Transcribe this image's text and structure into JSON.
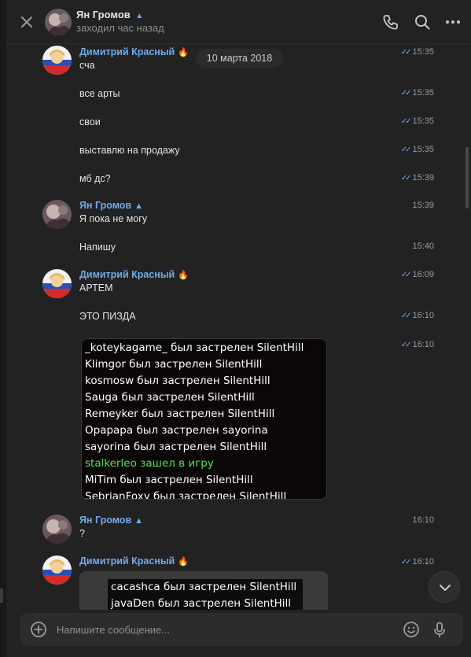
{
  "header": {
    "name": "Ян Громов",
    "status": "заходил час назад",
    "name_emoji": "🔥"
  },
  "date_separator": "10 марта 2018",
  "messages": [
    {
      "author": "Димитрий Красный",
      "emoji": "🔥",
      "text": "сча",
      "time": "15:35",
      "read": true
    },
    {
      "text": "все арты",
      "time": "15:35",
      "read": true
    },
    {
      "text": "свои",
      "time": "15:35",
      "read": true
    },
    {
      "text": "выставлю на продажу",
      "time": "15:35",
      "read": true
    },
    {
      "text": "мб дс?",
      "time": "15:39",
      "read": true
    },
    {
      "author": "Ян Громов",
      "emoji": "🔥",
      "text": "Я пока не могу",
      "time": "15:39",
      "read": false
    },
    {
      "text": "Напишу",
      "time": "15:40",
      "read": false
    },
    {
      "author": "Димитрий Красный",
      "emoji": "🔥",
      "text": "АРТЕМ",
      "time": "16:09",
      "read": true
    },
    {
      "text": "ЭТО ПИЗДА",
      "time": "16:10",
      "read": true
    },
    {
      "time": "16:10",
      "read": true
    },
    {
      "author": "Ян Громов",
      "emoji": "🔥",
      "text": "?",
      "time": "16:10",
      "read": false
    },
    {
      "author": "Димитрий Красный",
      "emoji": "🔥",
      "time": "16:10",
      "read": true
    }
  ],
  "screenshot_lines": [
    "_koteykagame_ был застрелен SilentHill",
    "Klimgor был застрелен SilentHill",
    "kosmosw был застрелен SilentHill",
    "Sauga был застрелен SilentHill",
    "Remeyker был застрелен SilentHill",
    "Opapapa был застрелен sayorina",
    "sayorina был застрелен SilentHill",
    "stalkerleo зашел в игру",
    "MiTim был застрелен SilentHill",
    "SebrianFoxy был застрелен SilentHill"
  ],
  "screenshot2_lines": [
    "cacashca был застрелен SilentHill",
    "javaDen был застрелен SilentHill"
  ],
  "composer": {
    "placeholder": "Напишите сообщение..."
  },
  "colors": {
    "author_blue": "#71aaeb",
    "background": "#222222",
    "game_join_green": "#4be34b"
  },
  "icons": [
    "close-icon",
    "phone-icon",
    "search-icon",
    "more-icon",
    "double-check-icon",
    "chevron-down-icon",
    "attach-plus-icon",
    "emoji-icon",
    "microphone-icon"
  ]
}
